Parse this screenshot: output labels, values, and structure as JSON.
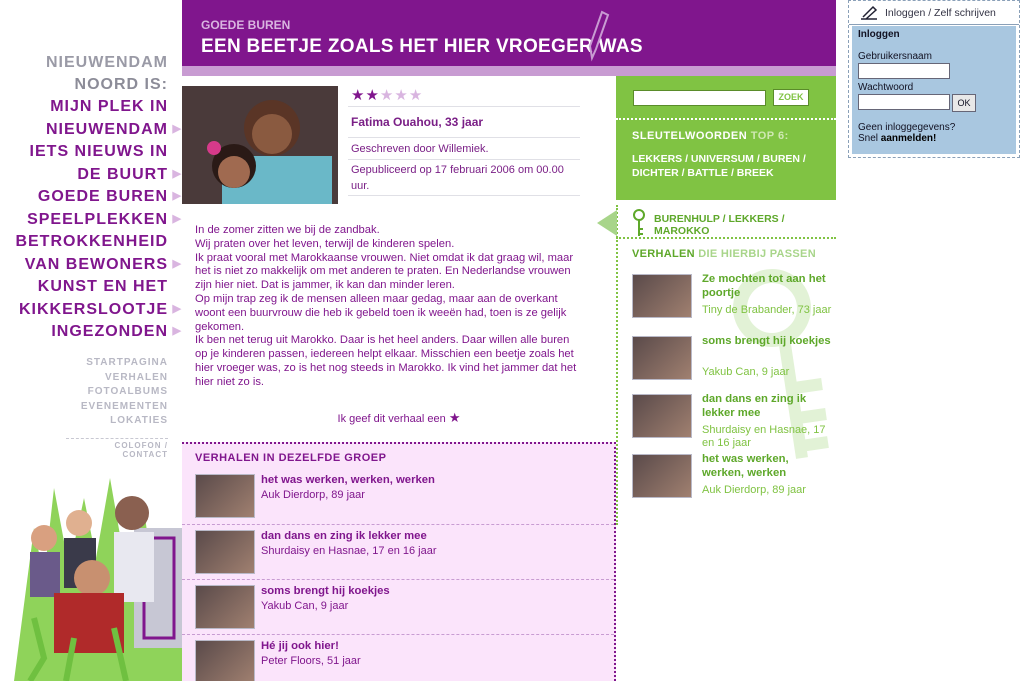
{
  "nav": {
    "lead": [
      "NIEUWENDAM",
      "NOORD IS:"
    ],
    "items": [
      [
        "MIJN PLEK IN",
        "NIEUWENDAM"
      ],
      [
        "IETS NIEUWS IN",
        "DE BUURT"
      ],
      [
        "GOEDE BUREN"
      ],
      [
        "SPEELPLEKKEN"
      ],
      [
        "BETROKKENHEID",
        "VAN BEWONERS"
      ],
      [
        "KUNST EN HET",
        "KIKKERSLOOTJE"
      ],
      [
        "INGEZONDEN"
      ]
    ],
    "sub": [
      "STARTPAGINA",
      "VERHALEN",
      "FOTOALBUMS",
      "EVENEMENTEN",
      "LOKATIES"
    ],
    "colofon": "COLOFON / CONTACT"
  },
  "header": {
    "section": "GOEDE BUREN",
    "title": "EEN BEETJE ZOALS HET HIER VROEGER WAS"
  },
  "story": {
    "rating": 2,
    "rating_max": 5,
    "subject": "Fatima Ouahou, 33 jaar",
    "author": "Geschreven door Willemiek.",
    "published": "Gepubliceerd op 17 februari 2006 om 00.00 uur.",
    "text": "In de zomer zitten we bij de zandbak.\nWij praten over het leven, terwijl de kinderen spelen.\nIk praat vooral met Marokkaanse vrouwen. Niet omdat ik dat graag wil, maar het is niet zo makkelijk om met anderen te praten. En Nederlandse vrouwen zijn hier niet. Dat is jammer, ik kan dan minder leren.\nOp mijn trap zeg ik de mensen alleen maar gedag, maar aan de overkant woont een buurvrouw die heb ik gebeld toen ik weeën had, toen is ze gelijk gekomen.\nIk ben net terug uit Marokko. Daar is het heel anders. Daar willen alle buren op je kinderen passen, iedereen helpt elkaar. Misschien een beetje zoals het hier vroeger was, zo is het nog steeds in Marokko. Ik vind het jammer dat het hier niet zo is.",
    "rate_label": "Ik geef dit verhaal een"
  },
  "group": {
    "heading": "VERHALEN IN DEZELFDE GROEP",
    "items": [
      {
        "title": "het was werken, werken, werken",
        "author": "Auk Dierdorp, 89 jaar"
      },
      {
        "title": "dan dans en zing ik lekker mee",
        "author": "Shurdaisy en Hasnae, 17 en 16 jaar"
      },
      {
        "title": "soms brengt hij koekjes",
        "author": "Yakub Can, 9 jaar"
      },
      {
        "title": "Hé jij ook hier!",
        "author": "Peter Floors, 51 jaar"
      }
    ]
  },
  "search": {
    "button": "ZOEK",
    "value": ""
  },
  "keywords": {
    "heading": "SLEUTELWOORDEN",
    "heading_accent": "TOP 6:",
    "list": "LEKKERS / UNIVERSUM / BUREN / DICHTER / BATTLE / BREEK",
    "story_keys": "BURENHULP / LEKKERS / MAROKKO"
  },
  "related": {
    "heading": "VERHALEN",
    "heading_accent": "DIE HIERBIJ PASSEN",
    "items": [
      {
        "title": "Ze mochten tot aan het poortje",
        "author": "Tiny de Brabander, 73 jaar"
      },
      {
        "title": "soms brengt hij koekjes",
        "author": "Yakub Can, 9 jaar"
      },
      {
        "title": "dan dans en zing ik lekker mee",
        "author": "Shurdaisy en Hasnae, 17 en 16 jaar"
      },
      {
        "title": "het was werken, werken, werken",
        "author": "Auk Dierdorp, 89 jaar"
      }
    ]
  },
  "login": {
    "top": "Inloggen / Zelf schrijven",
    "heading": "Inloggen",
    "user_label": "Gebruikersnaam",
    "pass_label": "Wachtwoord",
    "ok": "OK",
    "no_account": "Geen inloggegevens?",
    "register_prefix": "Snel",
    "register_link": "aanmelden!"
  },
  "colors": {
    "purple": "#80168d",
    "green": "#80c343",
    "login_bg": "#a9c7e0"
  }
}
